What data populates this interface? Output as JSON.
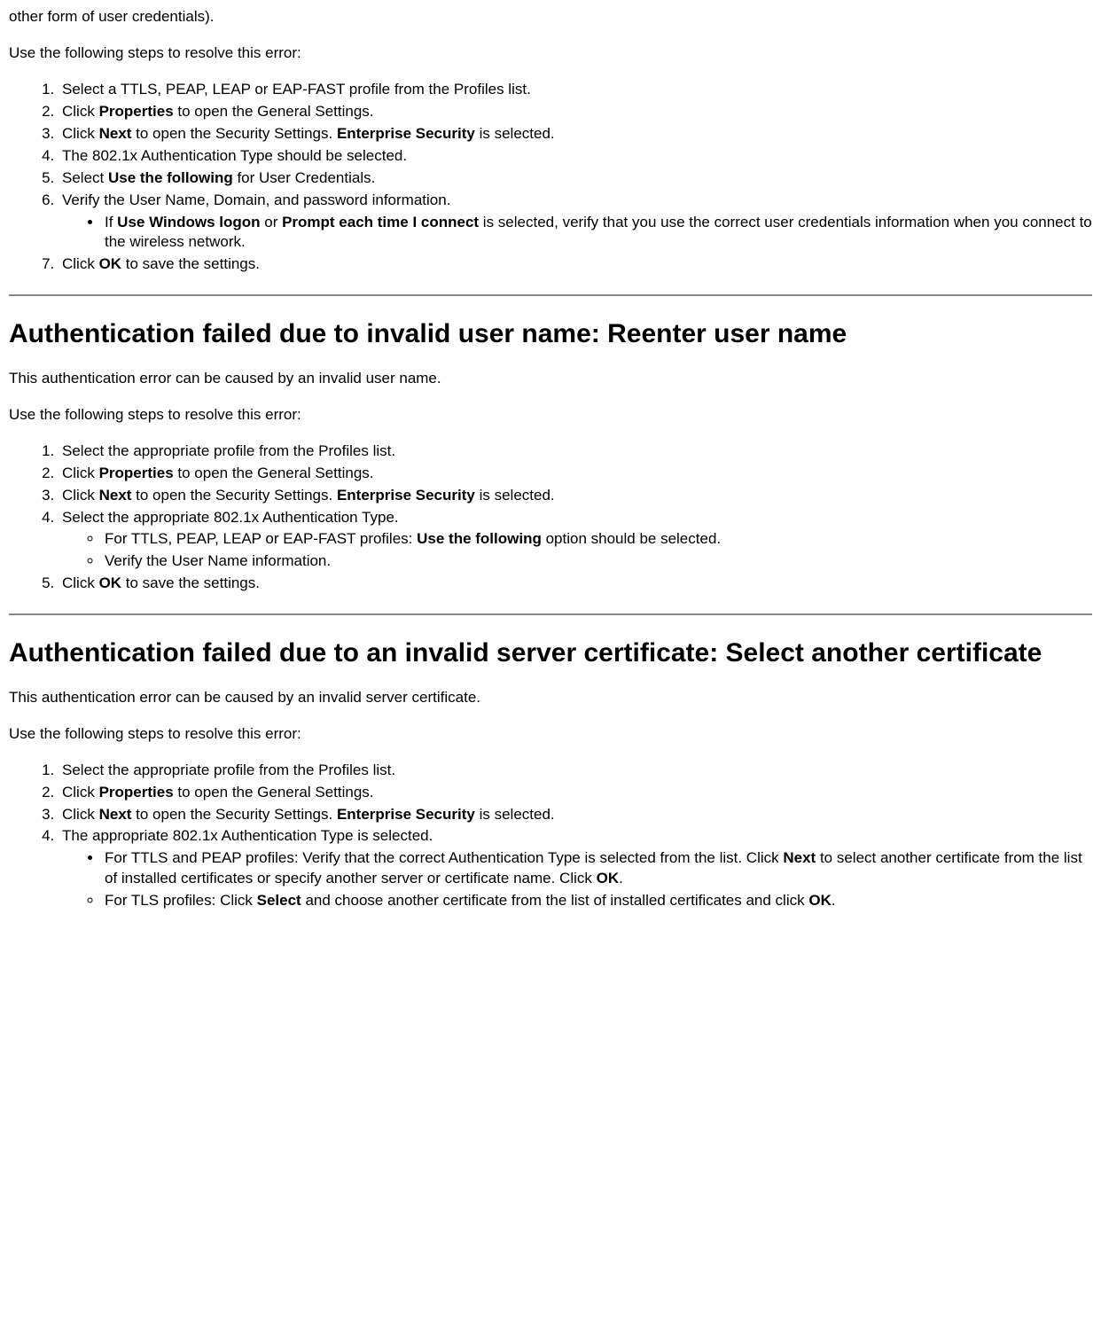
{
  "intro": {
    "fragment": "other form of user credentials).",
    "resolve": "Use the following steps to resolve this error:"
  },
  "section1": {
    "steps": [
      {
        "text": "Select a TTLS, PEAP, LEAP or EAP-FAST profile from the Profiles list."
      },
      {
        "pre": "Click ",
        "b1": "Properties",
        "post": " to open the General Settings."
      },
      {
        "pre": "Click ",
        "b1": "Next",
        "mid": " to open the Security Settings. ",
        "b2": "Enterprise Security",
        "post": " is selected."
      },
      {
        "text": "The 802.1x Authentication Type should be selected."
      },
      {
        "pre": "Select ",
        "b1": "Use the following",
        "post": " for User Credentials."
      },
      {
        "text": "Verify the User Name, Domain, and password information.",
        "sub": [
          {
            "pre": "If ",
            "b1": "Use Windows logon",
            "mid": " or ",
            "b2": "Prompt each time I connect",
            "post": " is selected, verify that you use the correct user credentials information when you connect to the wireless network."
          }
        ]
      },
      {
        "pre": "Click ",
        "b1": "OK",
        "post": " to save the settings."
      }
    ]
  },
  "section2": {
    "heading": "Authentication failed due to invalid user name: Reenter user name",
    "desc": "This authentication error can be caused by an invalid user name.",
    "resolve": "Use the following steps to resolve this error:",
    "steps": [
      {
        "text": "Select the appropriate profile from the Profiles list."
      },
      {
        "pre": "Click ",
        "b1": "Properties",
        "post": " to open the General Settings."
      },
      {
        "pre": "Click ",
        "b1": "Next",
        "mid": " to open the Security Settings. ",
        "b2": "Enterprise Security",
        "post": " is selected."
      },
      {
        "text": "Select the appropriate 802.1x Authentication Type.",
        "sub": [
          {
            "pre": "For TTLS, PEAP, LEAP or EAP-FAST profiles: ",
            "b1": "Use the following",
            "post": " option should be selected."
          },
          {
            "text": "Verify the User Name information."
          }
        ]
      },
      {
        "pre": "Click ",
        "b1": "OK",
        "post": " to save the settings."
      }
    ]
  },
  "section3": {
    "heading": "Authentication failed due to an invalid server certificate: Select another certificate",
    "desc": "This authentication error can be caused by an invalid server certificate.",
    "resolve": "Use the following steps to resolve this error:",
    "steps": [
      {
        "text": "Select the appropriate profile from the Profiles list."
      },
      {
        "pre": "Click ",
        "b1": "Properties",
        "post": " to open the General Settings."
      },
      {
        "pre": "Click ",
        "b1": "Next",
        "mid": " to open the Security Settings. ",
        "b2": "Enterprise Security",
        "post": " is selected."
      },
      {
        "text": "The appropriate 802.1x Authentication Type is selected.",
        "submix": [
          {
            "style": "disc",
            "pre": "For TTLS and PEAP profiles: Verify that the correct Authentication Type is selected from the list. Click ",
            "b1": "Next",
            "mid": " to select another certificate from the list of installed certificates or specify another server or certificate name. Click ",
            "b2": "OK",
            "post": "."
          },
          {
            "style": "circle",
            "pre": "For TLS profiles: Click ",
            "b1": "Select",
            "mid": " and choose another certificate from the list of installed certificates and click ",
            "b2": "OK",
            "post": "."
          }
        ]
      }
    ]
  }
}
